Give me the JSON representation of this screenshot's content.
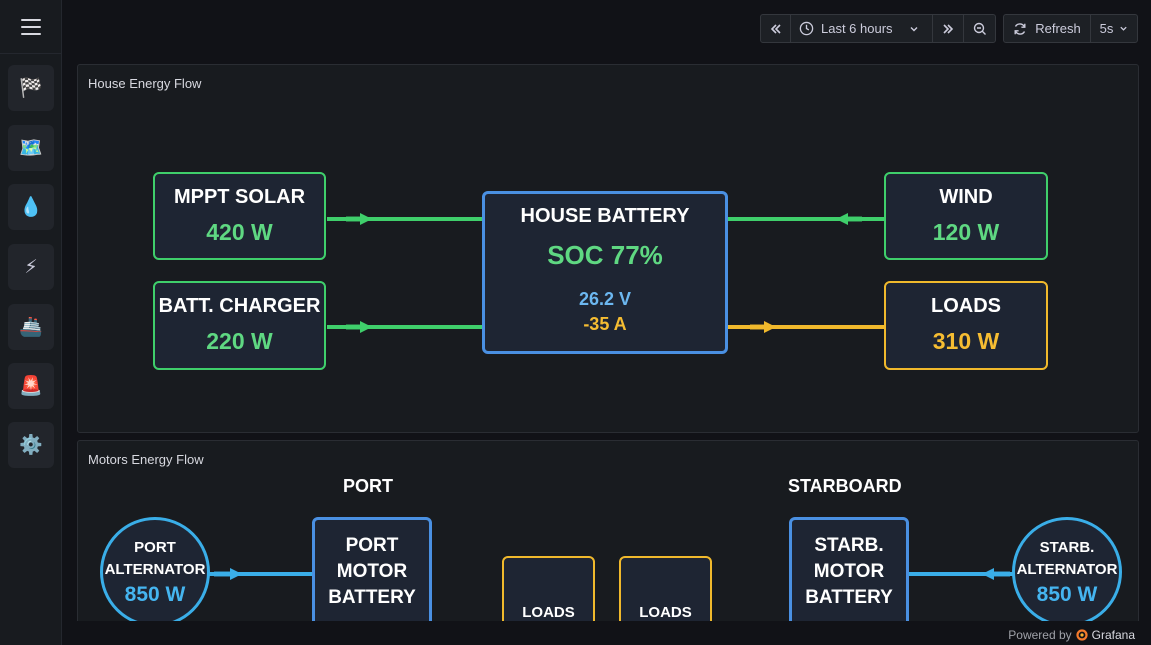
{
  "toolbar": {
    "time_range_label": "Last 6 hours",
    "refresh_label": "Refresh",
    "refresh_interval": "5s"
  },
  "sidebar": {
    "items": [
      {
        "icon": "checkered-flag-icon",
        "glyph": "🏁"
      },
      {
        "icon": "map-icon",
        "glyph": "🗺️"
      },
      {
        "icon": "water-drop-icon",
        "glyph": "💧"
      },
      {
        "icon": "lightning-icon",
        "glyph": "⚡"
      },
      {
        "icon": "ship-icon",
        "glyph": "🚢"
      },
      {
        "icon": "alarm-light-icon",
        "glyph": "🚨"
      },
      {
        "icon": "gear-icon",
        "glyph": "⚙️"
      }
    ]
  },
  "house_panel": {
    "title": "House Energy Flow",
    "mppt_solar": {
      "label": "MPPT SOLAR",
      "value": "420 W"
    },
    "batt_charger": {
      "label": "BATT. CHARGER",
      "value": "220 W"
    },
    "house_battery": {
      "label": "HOUSE BATTERY",
      "soc": "SOC 77%",
      "voltage": "26.2 V",
      "current": "-35 A"
    },
    "wind": {
      "label": "WIND",
      "value": "120 W"
    },
    "loads": {
      "label": "LOADS",
      "value": "310 W"
    }
  },
  "motors_panel": {
    "title": "Motors Energy Flow",
    "port_label": "PORT",
    "starboard_label": "STARBOARD",
    "port_alternator": {
      "line1": "PORT",
      "line2": "ALTERNATOR",
      "value": "850 W"
    },
    "port_motor_battery": {
      "line1": "PORT",
      "line2": "MOTOR",
      "line3": "BATTERY"
    },
    "loads_1": "LOADS",
    "loads_2": "LOADS",
    "starb_motor_battery": {
      "line1": "STARB.",
      "line2": "MOTOR",
      "line3": "BATTERY"
    },
    "starb_alternator": {
      "line1": "STARB.",
      "line2": "ALTERNATOR",
      "value": "850 W"
    }
  },
  "footer": {
    "powered_by": "Powered by",
    "brand": "Grafana"
  },
  "colors": {
    "green": "#3fcf6b",
    "yellow": "#f0b92c",
    "blue": "#4a90e2",
    "cyan": "#3aaee8",
    "background": "#111217"
  }
}
